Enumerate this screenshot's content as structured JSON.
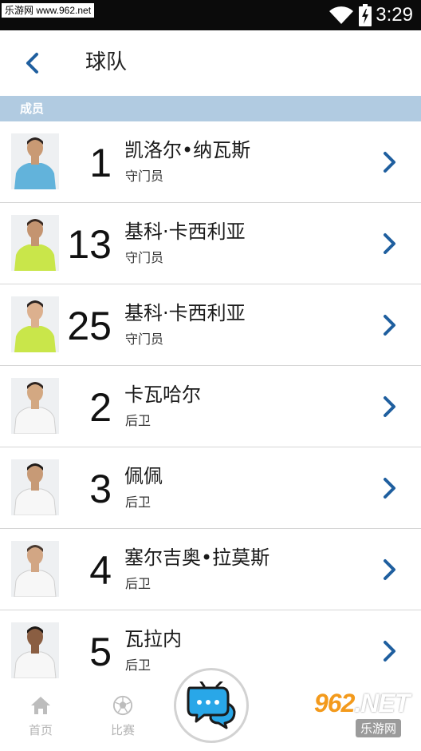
{
  "status_bar": {
    "watermark": "乐游网 www.962.net",
    "time": "3:29"
  },
  "header": {
    "title": "球队"
  },
  "section": {
    "label": "成员"
  },
  "players": [
    {
      "number": "1",
      "name": "凯洛尔•纳瓦斯",
      "position": "守门员",
      "kit_color": "#62b3db"
    },
    {
      "number": "13",
      "name": "基科·卡西利亚",
      "position": "守门员",
      "kit_color": "#c9e64a"
    },
    {
      "number": "25",
      "name": "基科·卡西利亚",
      "position": "守门员",
      "kit_color": "#c9e64a"
    },
    {
      "number": "2",
      "name": "卡瓦哈尔",
      "position": "后卫",
      "kit_color": "#f7f7f7"
    },
    {
      "number": "3",
      "name": "佩佩",
      "position": "后卫",
      "kit_color": "#f7f7f7"
    },
    {
      "number": "4",
      "name": "塞尔吉奥•拉莫斯",
      "position": "后卫",
      "kit_color": "#f7f7f7"
    },
    {
      "number": "5",
      "name": "瓦拉内",
      "position": "后卫",
      "kit_color": "#f7f7f7"
    }
  ],
  "bottom_nav": {
    "home_label": "首页",
    "match_label": "比赛"
  },
  "brand": {
    "main": "962",
    "suffix": ".NET",
    "sub": "乐游网"
  },
  "colors": {
    "accent": "#1f5f9f",
    "section_bg": "#b1cbe1",
    "chat_blue": "#29a7e8"
  },
  "icons": {
    "back": "chevron-left-icon",
    "row": "chevron-right-icon",
    "home": "home-icon",
    "match": "soccer-ball-icon",
    "chat": "chat-bubble-icon"
  }
}
